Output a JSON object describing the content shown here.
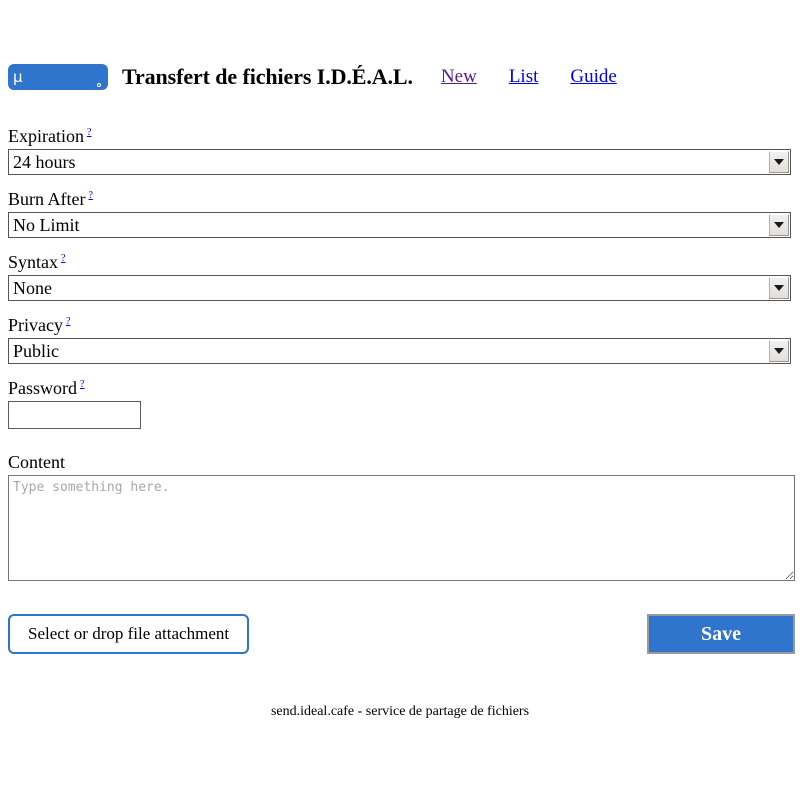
{
  "header": {
    "logo_glyph": "µ",
    "logo_icon": "ideal-logo-icon",
    "title": "Transfert de fichiers I.D.É.A.L.",
    "nav": [
      {
        "label": "New",
        "state": "visited"
      },
      {
        "label": "List",
        "state": "unvisited"
      },
      {
        "label": "Guide",
        "state": "unvisited"
      }
    ]
  },
  "form": {
    "help_marker": "?",
    "expiration": {
      "label": "Expiration",
      "value": "24 hours"
    },
    "burn_after": {
      "label": "Burn After",
      "value": "No Limit"
    },
    "syntax": {
      "label": "Syntax",
      "value": "None"
    },
    "privacy": {
      "label": "Privacy",
      "value": "Public"
    },
    "password": {
      "label": "Password",
      "value": "",
      "placeholder": ""
    },
    "content": {
      "label": "Content",
      "value": "",
      "placeholder": "Type something here."
    }
  },
  "actions": {
    "file_button": "Select or drop file attachment",
    "save_button": "Save"
  },
  "footer": {
    "text": "send.ideal.cafe - service de partage de fichiers"
  },
  "colors": {
    "brand_blue": "#2f74cd",
    "link_unvisited": "#0000ee",
    "link_visited": "#551a8b",
    "placeholder_gray": "#a8a8a8"
  }
}
